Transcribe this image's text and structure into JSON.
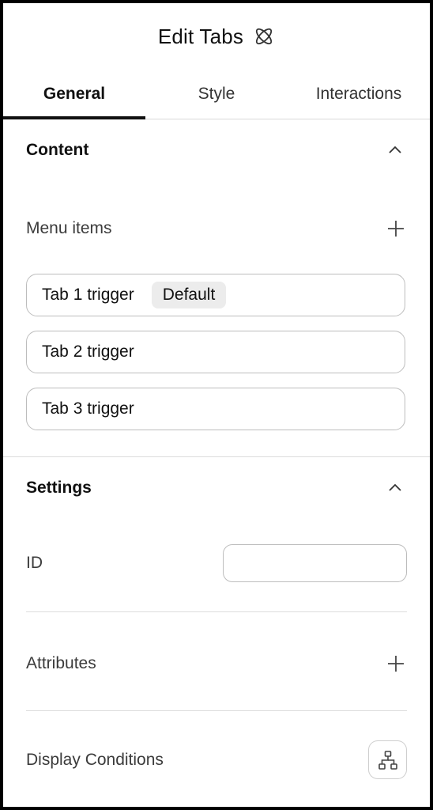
{
  "header": {
    "title": "Edit Tabs",
    "icon": "atom-icon"
  },
  "tabs": [
    {
      "label": "General",
      "active": true
    },
    {
      "label": "Style",
      "active": false
    },
    {
      "label": "Interactions",
      "active": false
    }
  ],
  "content_section": {
    "title": "Content",
    "menu_items_label": "Menu items",
    "items": [
      {
        "label": "Tab 1 trigger",
        "badge": "Default"
      },
      {
        "label": "Tab 2 trigger"
      },
      {
        "label": "Tab 3 trigger"
      }
    ]
  },
  "settings_section": {
    "title": "Settings",
    "id_label": "ID",
    "id_value": "",
    "attributes_label": "Attributes",
    "display_conditions_label": "Display Conditions"
  },
  "colors": {
    "text": "#111111",
    "border": "#bdbdbd",
    "badge_bg": "#ececec",
    "active_tab_indicator": "#111111"
  }
}
